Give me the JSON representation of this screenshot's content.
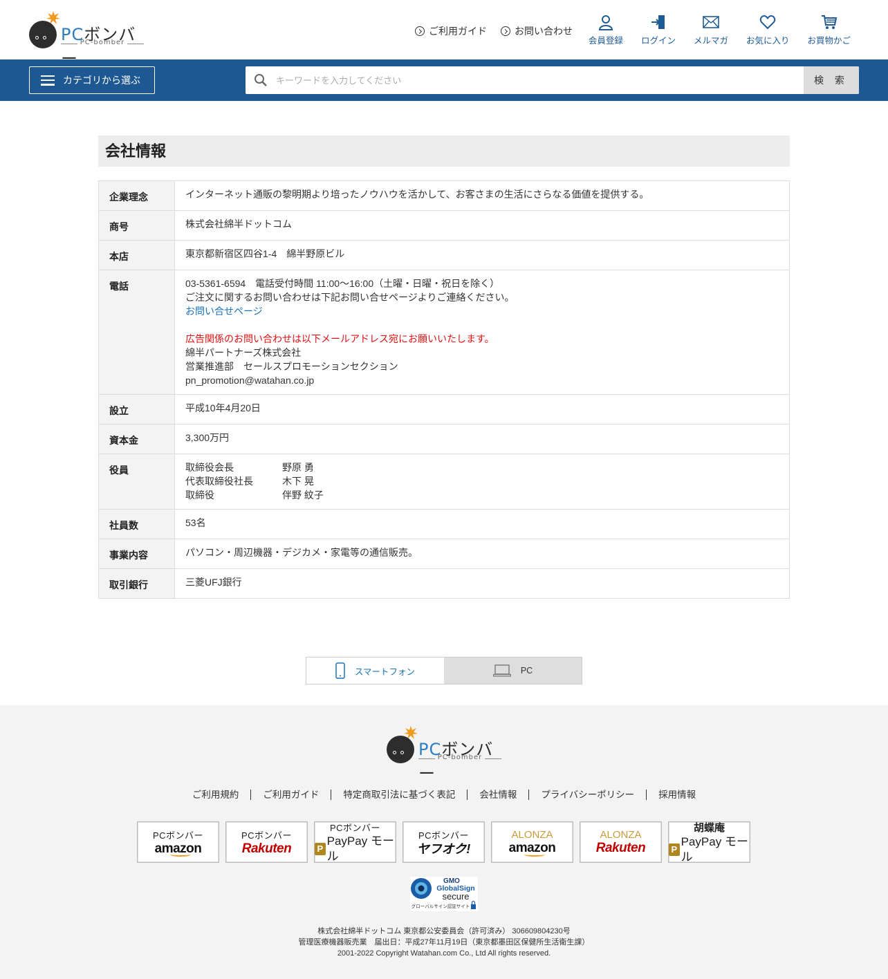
{
  "header": {
    "logo_text_pc": "PC",
    "logo_text_rest": "ボンバー",
    "logo_sub": "PC-bomber",
    "links": [
      {
        "label": "ご利用ガイド"
      },
      {
        "label": "お問い合わせ"
      }
    ],
    "icons": [
      {
        "label": "会員登録",
        "icon": "person-icon"
      },
      {
        "label": "ログイン",
        "icon": "login-icon"
      },
      {
        "label": "メルマガ",
        "icon": "mail-icon"
      },
      {
        "label": "お気に入り",
        "icon": "heart-icon"
      },
      {
        "label": "お買物かご",
        "icon": "cart-icon"
      }
    ]
  },
  "nav": {
    "category_label": "カテゴリから選ぶ",
    "search_placeholder": "キーワードを入力してください",
    "search_button": "検 索"
  },
  "page": {
    "title": "会社情報",
    "rows": {
      "philosophy": {
        "label": "企業理念",
        "value": "インターネット通販の黎明期より培ったノウハウを活かして、お客さまの生活にさらなる価値を提供する。"
      },
      "name": {
        "label": "商号",
        "value": "株式会社綿半ドットコム"
      },
      "hq": {
        "label": "本店",
        "value": "東京都新宿区四谷1-4　綿半野原ビル"
      },
      "phone": {
        "label": "電話",
        "line1": "03-5361-6594　電話受付時間 11:00～16:00（土曜・日曜・祝日を除く）",
        "line2": "ご注文に関するお問い合わせは下記お問い合せページよりご連絡ください。",
        "link": "お問い合せページ",
        "ad_note": "広告関係のお問い合わせは以下メールアドレス宛にお願いいたします。",
        "company": "綿半パートナーズ株式会社",
        "dept": "営業推進部　セールスプロモーションセクション",
        "email": "pn_promotion@watahan.co.jp"
      },
      "founded": {
        "label": "設立",
        "value": "平成10年4月20日"
      },
      "capital": {
        "label": "資本金",
        "value": "3,300万円"
      },
      "officers": {
        "label": "役員",
        "list": [
          {
            "title": "取締役会長",
            "name": "野原 勇"
          },
          {
            "title": "代表取締役社長",
            "name": "木下 晃"
          },
          {
            "title": "取締役",
            "name": "伴野 紋子"
          }
        ]
      },
      "employees": {
        "label": "社員数",
        "value": "53名"
      },
      "business": {
        "label": "事業内容",
        "value": "パソコン・周辺機器・デジカメ・家電等の通信販売。"
      },
      "bank": {
        "label": "取引銀行",
        "value": "三菱UFJ銀行"
      }
    }
  },
  "switcher": {
    "smartphone": "スマートフォン",
    "pc": "PC"
  },
  "footer": {
    "links": [
      "ご利用規約",
      "ご利用ガイド",
      "特定商取引法に基づく表記",
      "会社情報",
      "プライバシーポリシー",
      "採用情報"
    ],
    "banners": [
      {
        "top": "PCボンバー",
        "bottom": "amazon"
      },
      {
        "top": "PCボンバー",
        "bottom": "Rakuten"
      },
      {
        "top": "PCボンバー",
        "bottom": "PayPay モール"
      },
      {
        "top": "PCボンバー",
        "bottom": "ヤフオク!"
      },
      {
        "top": "ALONZA",
        "bottom": "amazon"
      },
      {
        "top": "ALONZA",
        "bottom": "Rakuten"
      },
      {
        "top": "胡蝶庵",
        "bottom": "PayPay モール"
      }
    ],
    "gmo": {
      "line1": "GMO",
      "line2": "GlobalSign",
      "line3": "secure",
      "line4": "グローバルサイン認証サイト"
    },
    "copy_lines": [
      "株式会社綿半ドットコム 東京都公安委員会（許可済み） 306609804230号",
      "管理医療機器販売業　届出日：平成27年11月19日（東京都墨田区保健所生活衛生課）",
      "2001-2022 Copyright Watahan.com Co., Ltd All rights reserved."
    ]
  }
}
